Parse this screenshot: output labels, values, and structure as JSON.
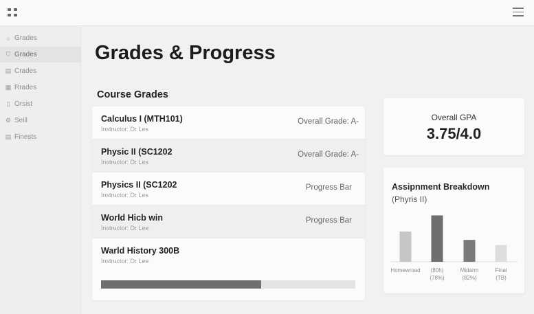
{
  "sidebar": {
    "items": [
      {
        "icon": "circle-icon",
        "glyph": "○",
        "label": "Grades"
      },
      {
        "icon": "shield-icon",
        "glyph": "⛉",
        "label": "Grades"
      },
      {
        "icon": "calendar-icon",
        "glyph": "▤",
        "label": "Crades"
      },
      {
        "icon": "table-icon",
        "glyph": "▦",
        "label": "Rrades"
      },
      {
        "icon": "document-icon",
        "glyph": "▯",
        "label": "Orsist"
      },
      {
        "icon": "settings-icon",
        "glyph": "⚙",
        "label": "Seill"
      },
      {
        "icon": "list-icon",
        "glyph": "▤",
        "label": "Finests"
      }
    ],
    "active_index": 1
  },
  "main": {
    "title": "Grades & Progress",
    "section_title": "Course Grades",
    "courses": [
      {
        "name": "Calculus I (MTH101)",
        "instructor": "Instructor: Dr Les",
        "right": "Overall Grade: A-"
      },
      {
        "name": "Physic II (SC1202",
        "instructor": "Instructor: Dr Les",
        "right": "Overall Grade: A-"
      },
      {
        "name": "Physics II (SC1202",
        "instructor": "Instructor: Dr Les",
        "right": "Progress Bar"
      },
      {
        "name": "World Hicb win",
        "instructor": "Instructor: Dr Lee",
        "right": "Progress Bar"
      },
      {
        "name": "Warld History 300B",
        "instructor": "Instructor: Dr Lee",
        "right": ""
      }
    ],
    "progress": 0.63
  },
  "gpa": {
    "label": "Overall GPA",
    "value": "3.75/4.0"
  },
  "breakdown": {
    "title": "Assipnment Breakdown",
    "subtitle": "(Phyris II)"
  },
  "chart_data": {
    "type": "bar",
    "categories": [
      "Homework",
      "(80%)",
      "Midterm",
      "Final"
    ],
    "values": [
      47,
      72,
      34,
      26
    ],
    "tick_labels": [
      [
        "Homewroad"
      ],
      [
        "(80h)",
        "(78%)"
      ],
      [
        "Midarm",
        "(82%)"
      ],
      [
        "Final",
        "(TB)"
      ]
    ],
    "colors": [
      "#c6c6c6",
      "#6e6e6e",
      "#7a7a7a",
      "#dedede"
    ],
    "ylim": [
      0,
      80
    ],
    "grid": false,
    "legend": "none"
  }
}
